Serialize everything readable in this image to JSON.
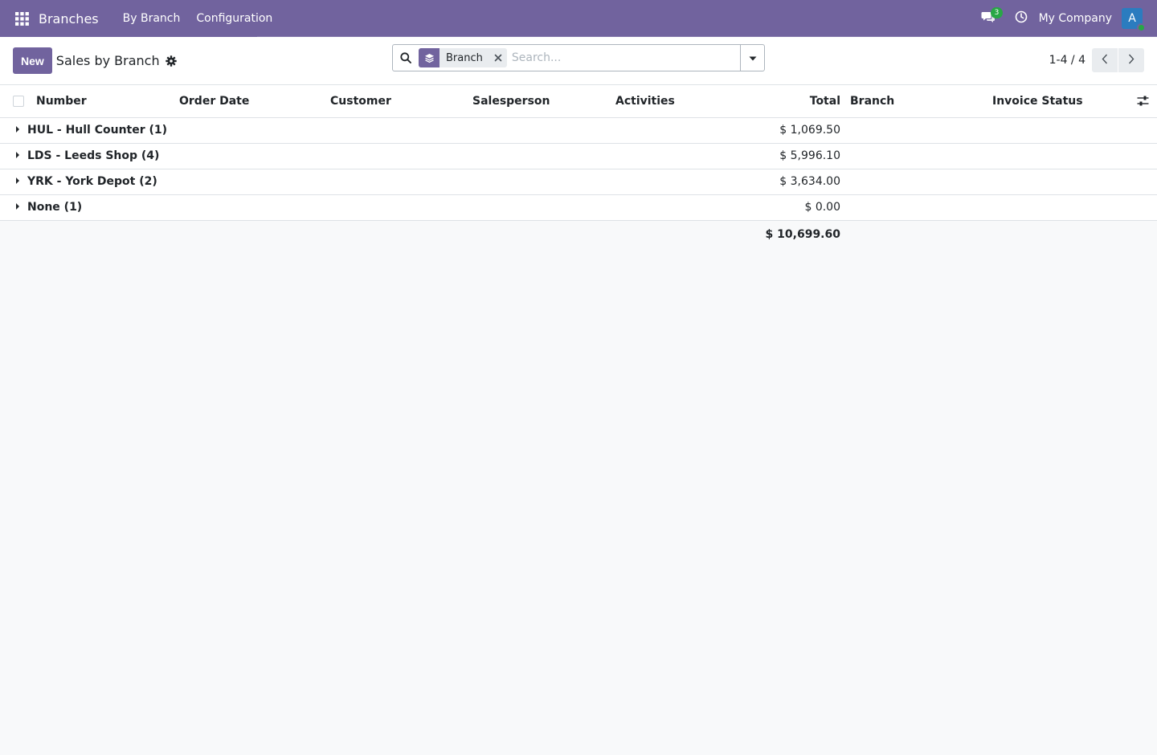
{
  "navbar": {
    "app_name": "Branches",
    "menu": [
      {
        "label": "By Branch"
      },
      {
        "label": "Configuration"
      }
    ],
    "messages_count": "3",
    "company": "My Company",
    "avatar_initial": "A",
    "color": "#71639e"
  },
  "control_panel": {
    "new_label": "New",
    "title": "Sales by Branch",
    "search": {
      "facet_label": "Branch",
      "placeholder": "Search..."
    },
    "pager": "1-4 / 4"
  },
  "table": {
    "columns": [
      "Number",
      "Order Date",
      "Customer",
      "Salesperson",
      "Activities",
      "Total",
      "Branch",
      "Invoice Status"
    ],
    "groups": [
      {
        "name": "HUL - Hull Counter (1)",
        "total": "$ 1,069.50"
      },
      {
        "name": "LDS - Leeds Shop (4)",
        "total": "$ 5,996.10"
      },
      {
        "name": "YRK - York Depot (2)",
        "total": "$ 3,634.00"
      },
      {
        "name": "None (1)",
        "total": "$ 0.00"
      }
    ],
    "grand_total": "$ 10,699.60"
  }
}
